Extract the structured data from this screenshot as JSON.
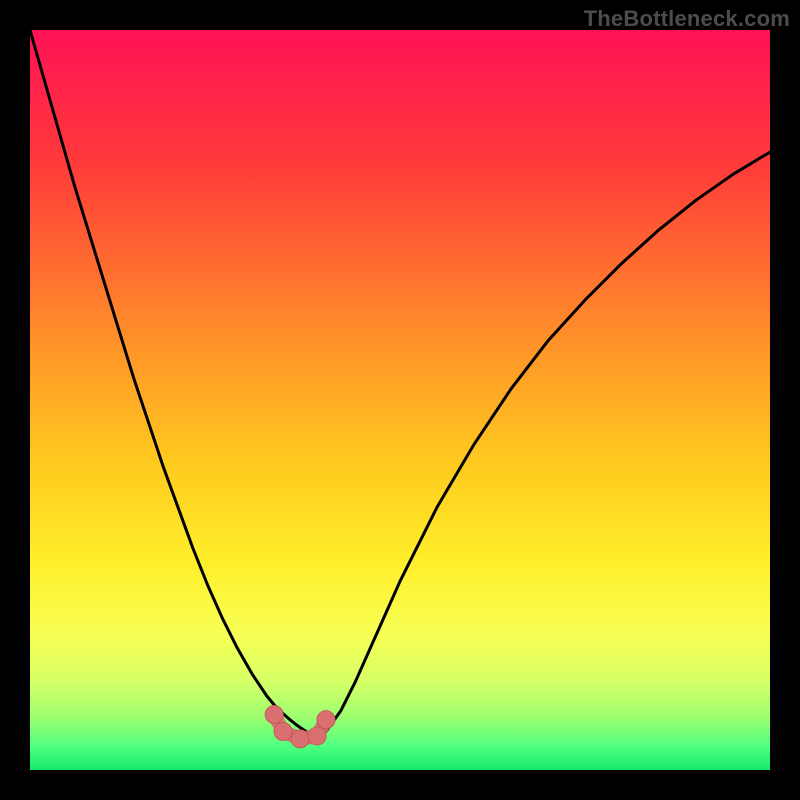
{
  "watermark": "TheBottleneck.com",
  "colors": {
    "frame_bg": "#000000",
    "watermark": "#4c4c4c",
    "curve": "#000000",
    "marker_fill": "#d96f6f",
    "marker_stroke": "#c45a5a",
    "gradient_stops": [
      {
        "offset": 0.0,
        "color": "#ff1255"
      },
      {
        "offset": 0.18,
        "color": "#ff3a3a"
      },
      {
        "offset": 0.4,
        "color": "#ff8a2a"
      },
      {
        "offset": 0.58,
        "color": "#ffc81e"
      },
      {
        "offset": 0.72,
        "color": "#ffef2a"
      },
      {
        "offset": 0.82,
        "color": "#f7ff55"
      },
      {
        "offset": 0.88,
        "color": "#d6ff66"
      },
      {
        "offset": 0.93,
        "color": "#9bff70"
      },
      {
        "offset": 0.97,
        "color": "#4cff80"
      },
      {
        "offset": 1.0,
        "color": "#17e86b"
      }
    ]
  },
  "chart_data": {
    "type": "line",
    "title": "",
    "xlabel": "",
    "ylabel": "",
    "xlim": [
      0,
      100
    ],
    "ylim": [
      0,
      100
    ],
    "x": [
      0,
      2,
      4,
      6,
      8,
      10,
      12,
      14,
      16,
      18,
      20,
      22,
      24,
      26,
      28,
      30,
      32,
      33,
      34,
      35,
      36,
      37,
      38,
      39,
      40,
      42,
      44,
      46,
      48,
      50,
      55,
      60,
      65,
      70,
      75,
      80,
      85,
      90,
      95,
      100
    ],
    "values": [
      100,
      93,
      86,
      79,
      72.5,
      66,
      59.5,
      53,
      47,
      41,
      35.5,
      30,
      25,
      20.5,
      16.5,
      13,
      10,
      8.8,
      7.8,
      6.9,
      6.1,
      5.4,
      4.8,
      4.6,
      5.2,
      8,
      12,
      16.5,
      21,
      25.5,
      35.5,
      44,
      51.5,
      58,
      63.5,
      68.5,
      73,
      77,
      80.5,
      83.5
    ],
    "annotations": {
      "markers": [
        {
          "x": 33.0,
          "y": 7.5
        },
        {
          "x": 34.2,
          "y": 5.2
        },
        {
          "x": 36.5,
          "y": 4.2
        },
        {
          "x": 38.8,
          "y": 4.6
        },
        {
          "x": 40.0,
          "y": 6.8
        }
      ],
      "connector_path": [
        {
          "x": 33.0,
          "y": 7.5
        },
        {
          "x": 34.2,
          "y": 5.2
        },
        {
          "x": 36.5,
          "y": 4.2
        },
        {
          "x": 38.8,
          "y": 4.6
        },
        {
          "x": 40.0,
          "y": 6.8
        }
      ]
    }
  }
}
